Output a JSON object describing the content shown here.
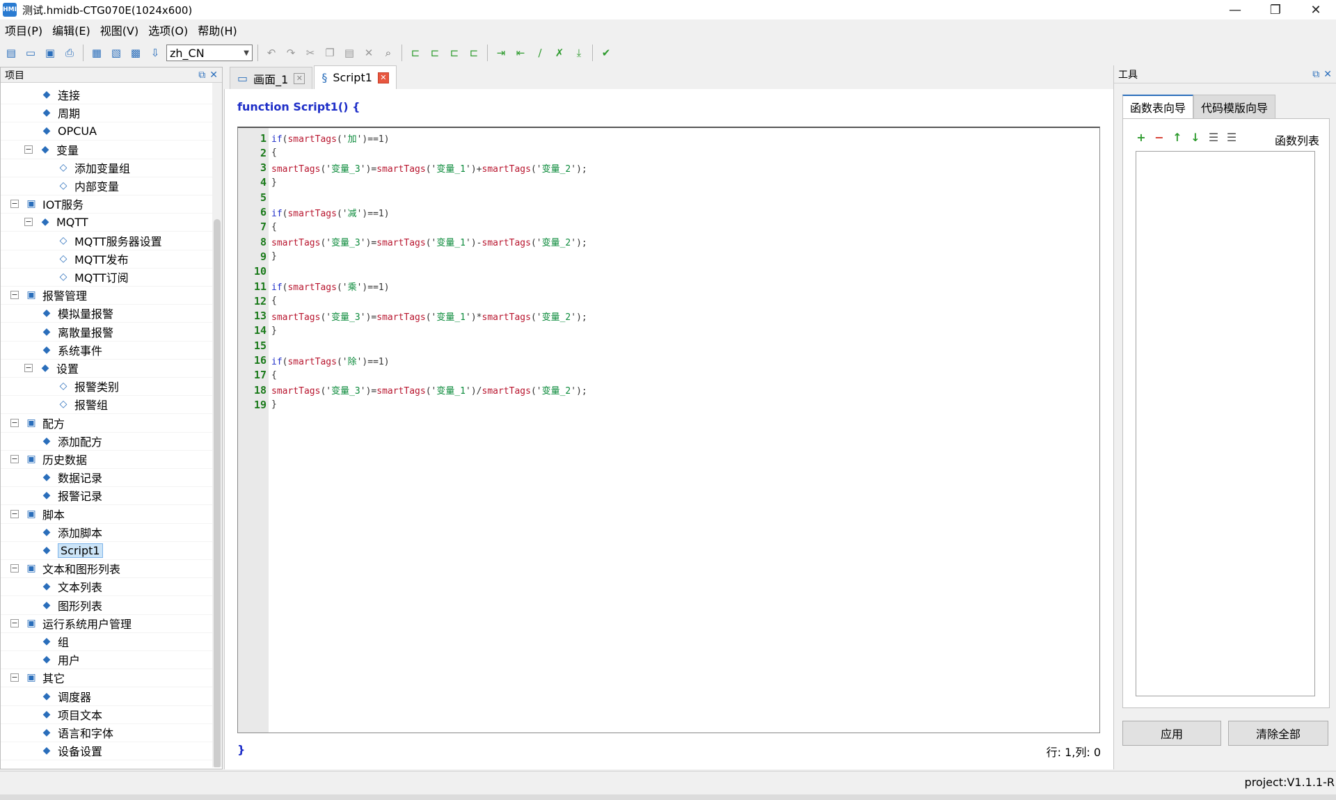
{
  "window": {
    "title": "测试.hmidb-CTG070E(1024x600)",
    "minimize": "—",
    "restore": "❐",
    "close": "✕"
  },
  "menu": [
    "项目(P)",
    "编辑(E)",
    "视图(V)",
    "选项(O)",
    "帮助(H)"
  ],
  "toolbar": {
    "language": "zh_CN"
  },
  "left_panel": {
    "title": "项目",
    "tree": [
      {
        "label": "连接",
        "level": 2,
        "icon": "connection-icon"
      },
      {
        "label": "周期",
        "level": 2,
        "icon": "cycle-icon"
      },
      {
        "label": "OPCUA",
        "level": 2,
        "icon": "opcua-icon"
      },
      {
        "label": "变量",
        "level": 2,
        "icon": "variable-folder-icon",
        "expander": "−"
      },
      {
        "label": "添加变量组",
        "level": 3,
        "icon": "add-variable-group-icon"
      },
      {
        "label": "内部变量",
        "level": 3,
        "icon": "internal-variable-icon"
      },
      {
        "label": "IOT服务",
        "level": 1,
        "icon": "iot-service-icon",
        "expander": "−"
      },
      {
        "label": "MQTT",
        "level": 2,
        "icon": "mqtt-icon",
        "expander": "−"
      },
      {
        "label": "MQTT服务器设置",
        "level": 3,
        "icon": "mqtt-icon"
      },
      {
        "label": "MQTT发布",
        "level": 3,
        "icon": "mqtt-icon"
      },
      {
        "label": "MQTT订阅",
        "level": 3,
        "icon": "mqtt-icon"
      },
      {
        "label": "报警管理",
        "level": 1,
        "icon": "alarm-folder-icon",
        "expander": "−"
      },
      {
        "label": "模拟量报警",
        "level": 2,
        "icon": "analog-alarm-icon"
      },
      {
        "label": "离散量报警",
        "level": 2,
        "icon": "discrete-alarm-icon"
      },
      {
        "label": "系统事件",
        "level": 2,
        "icon": "system-event-icon"
      },
      {
        "label": "设置",
        "level": 2,
        "icon": "settings-icon",
        "expander": "−"
      },
      {
        "label": "报警类别",
        "level": 3,
        "icon": "alarm-category-icon"
      },
      {
        "label": "报警组",
        "level": 3,
        "icon": "alarm-group-icon"
      },
      {
        "label": "配方",
        "level": 1,
        "icon": "recipe-folder-icon",
        "expander": "−"
      },
      {
        "label": "添加配方",
        "level": 2,
        "icon": "add-recipe-icon"
      },
      {
        "label": "历史数据",
        "level": 1,
        "icon": "history-folder-icon",
        "expander": "−"
      },
      {
        "label": "数据记录",
        "level": 2,
        "icon": "data-log-icon"
      },
      {
        "label": "报警记录",
        "level": 2,
        "icon": "alarm-log-icon"
      },
      {
        "label": "脚本",
        "level": 1,
        "icon": "script-folder-icon",
        "expander": "−"
      },
      {
        "label": "添加脚本",
        "level": 2,
        "icon": "add-script-icon"
      },
      {
        "label": "Script1",
        "level": 2,
        "icon": "script-icon",
        "selected": true
      },
      {
        "label": "文本和图形列表",
        "level": 1,
        "icon": "list-folder-icon",
        "expander": "−"
      },
      {
        "label": "文本列表",
        "level": 2,
        "icon": "text-list-icon"
      },
      {
        "label": "图形列表",
        "level": 2,
        "icon": "graphic-list-icon"
      },
      {
        "label": "运行系统用户管理",
        "level": 1,
        "icon": "user-admin-icon",
        "expander": "−"
      },
      {
        "label": "组",
        "level": 2,
        "icon": "group-icon"
      },
      {
        "label": "用户",
        "level": 2,
        "icon": "user-icon"
      },
      {
        "label": "其它",
        "level": 1,
        "icon": "other-folder-icon",
        "expander": "−"
      },
      {
        "label": "调度器",
        "level": 2,
        "icon": "scheduler-icon"
      },
      {
        "label": "项目文本",
        "level": 2,
        "icon": "project-text-icon"
      },
      {
        "label": "语言和字体",
        "level": 2,
        "icon": "language-font-icon"
      },
      {
        "label": "设备设置",
        "level": 2,
        "icon": "device-settings-icon"
      }
    ]
  },
  "editor": {
    "tabs": [
      {
        "label": "画面_1",
        "icon": "screen-icon",
        "active": false
      },
      {
        "label": "Script1",
        "icon": "script-icon",
        "active": true
      }
    ],
    "func_head": "function Script1() {",
    "func_tail": "}",
    "cursor_pos": "行: 1,列: 0",
    "lines": [
      {
        "n": "1",
        "parts": [
          [
            "kw",
            "if"
          ],
          [
            "pun",
            "("
          ],
          [
            "fn",
            "smartTags"
          ],
          [
            "pun",
            "('"
          ],
          [
            "str",
            "加"
          ],
          [
            "pun",
            "')==1)"
          ]
        ]
      },
      {
        "n": "2",
        "parts": [
          [
            "pun",
            "{"
          ]
        ]
      },
      {
        "n": "3",
        "parts": [
          [
            "fn",
            "smartTags"
          ],
          [
            "pun",
            "('"
          ],
          [
            "str",
            "变量_3"
          ],
          [
            "pun",
            "')="
          ],
          [
            "fn",
            "smartTags"
          ],
          [
            "pun",
            "('"
          ],
          [
            "str",
            "变量_1"
          ],
          [
            "pun",
            "')+"
          ],
          [
            "fn",
            "smartTags"
          ],
          [
            "pun",
            "('"
          ],
          [
            "str",
            "变量_2"
          ],
          [
            "pun",
            "');"
          ]
        ]
      },
      {
        "n": "4",
        "parts": [
          [
            "pun",
            "}"
          ]
        ]
      },
      {
        "n": "5",
        "parts": []
      },
      {
        "n": "6",
        "parts": [
          [
            "kw",
            "if"
          ],
          [
            "pun",
            "("
          ],
          [
            "fn",
            "smartTags"
          ],
          [
            "pun",
            "('"
          ],
          [
            "str",
            "减"
          ],
          [
            "pun",
            "')==1)"
          ]
        ]
      },
      {
        "n": "7",
        "parts": [
          [
            "pun",
            "{"
          ]
        ]
      },
      {
        "n": "8",
        "parts": [
          [
            "fn",
            "smartTags"
          ],
          [
            "pun",
            "('"
          ],
          [
            "str",
            "变量_3"
          ],
          [
            "pun",
            "')="
          ],
          [
            "fn",
            "smartTags"
          ],
          [
            "pun",
            "('"
          ],
          [
            "str",
            "变量_1"
          ],
          [
            "pun",
            "')-"
          ],
          [
            "fn",
            "smartTags"
          ],
          [
            "pun",
            "('"
          ],
          [
            "str",
            "变量_2"
          ],
          [
            "pun",
            "');"
          ]
        ]
      },
      {
        "n": "9",
        "parts": [
          [
            "pun",
            "}"
          ]
        ]
      },
      {
        "n": "10",
        "parts": []
      },
      {
        "n": "11",
        "parts": [
          [
            "kw",
            "if"
          ],
          [
            "pun",
            "("
          ],
          [
            "fn",
            "smartTags"
          ],
          [
            "pun",
            "('"
          ],
          [
            "str",
            "乘"
          ],
          [
            "pun",
            "')==1)"
          ]
        ]
      },
      {
        "n": "12",
        "parts": [
          [
            "pun",
            "{"
          ]
        ]
      },
      {
        "n": "13",
        "parts": [
          [
            "fn",
            "smartTags"
          ],
          [
            "pun",
            "('"
          ],
          [
            "str",
            "变量_3"
          ],
          [
            "pun",
            "')="
          ],
          [
            "fn",
            "smartTags"
          ],
          [
            "pun",
            "('"
          ],
          [
            "str",
            "变量_1"
          ],
          [
            "pun",
            "')*"
          ],
          [
            "fn",
            "smartTags"
          ],
          [
            "pun",
            "('"
          ],
          [
            "str",
            "变量_2"
          ],
          [
            "pun",
            "');"
          ]
        ]
      },
      {
        "n": "14",
        "parts": [
          [
            "pun",
            "}"
          ]
        ]
      },
      {
        "n": "15",
        "parts": []
      },
      {
        "n": "16",
        "parts": [
          [
            "kw",
            "if"
          ],
          [
            "pun",
            "("
          ],
          [
            "fn",
            "smartTags"
          ],
          [
            "pun",
            "('"
          ],
          [
            "str",
            "除"
          ],
          [
            "pun",
            "')==1)"
          ]
        ]
      },
      {
        "n": "17",
        "parts": [
          [
            "pun",
            "{"
          ]
        ]
      },
      {
        "n": "18",
        "parts": [
          [
            "fn",
            "smartTags"
          ],
          [
            "pun",
            "('"
          ],
          [
            "str",
            "变量_3"
          ],
          [
            "pun",
            "')="
          ],
          [
            "fn",
            "smartTags"
          ],
          [
            "pun",
            "('"
          ],
          [
            "str",
            "变量_1"
          ],
          [
            "pun",
            "')/"
          ],
          [
            "fn",
            "smartTags"
          ],
          [
            "pun",
            "('"
          ],
          [
            "str",
            "变量_2"
          ],
          [
            "pun",
            "');"
          ]
        ]
      },
      {
        "n": "19",
        "parts": [
          [
            "pun",
            "}"
          ]
        ]
      }
    ]
  },
  "right_panel": {
    "title": "工具",
    "tabs": [
      {
        "label": "函数表向导",
        "active": true
      },
      {
        "label": "代码模版向导",
        "active": false
      }
    ],
    "list_label": "函数列表",
    "apply": "应用",
    "clear_all": "清除全部"
  },
  "status": {
    "version": "project:V1.1.1-R"
  }
}
